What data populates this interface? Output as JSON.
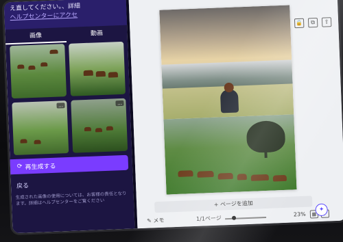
{
  "left_panel": {
    "header_text": "え直してください。",
    "help_link": "ヘルプセンターにアクセ",
    "help_suffix": "、詳細",
    "tabs": [
      {
        "label": "画像"
      },
      {
        "label": "動画"
      }
    ],
    "thumb_menu": "…",
    "regenerate_label": "再生成する",
    "back_label": "戻る",
    "fine_print": "生成された画像の使用については、お客様の責任となります。詳細はヘルプセンターをご覧ください"
  },
  "editor": {
    "top_icons": [
      {
        "icon": "lock-icon",
        "glyph": "🔒"
      },
      {
        "icon": "copy-icon",
        "glyph": "⧉"
      },
      {
        "icon": "share-icon",
        "glyph": "⇪"
      }
    ],
    "add_page_label": "+ ページを追加",
    "bottom": {
      "memo_label": "メモ",
      "pages_label": "1/1ページ",
      "zoom_label": "23%",
      "grid_glyph": "▦",
      "fullscreen_glyph": "⤢"
    },
    "fab_glyph": "✦"
  }
}
